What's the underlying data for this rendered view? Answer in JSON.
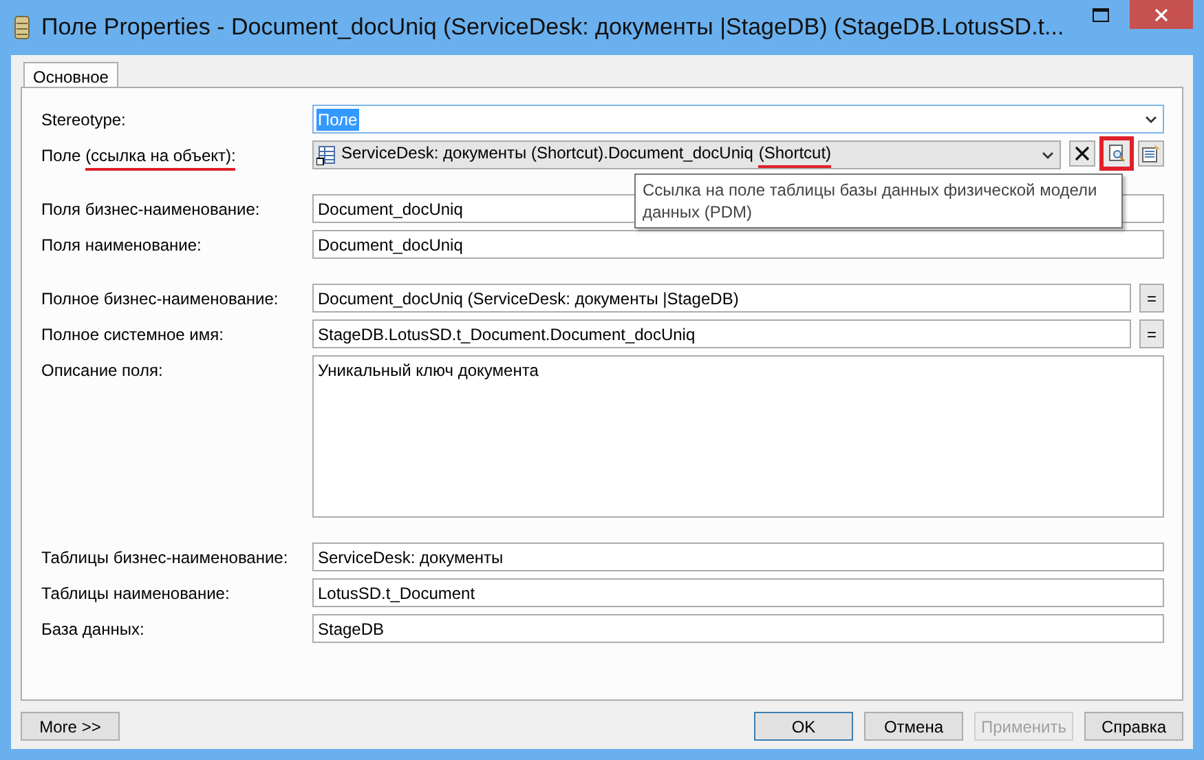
{
  "window": {
    "title": "Поле Properties - Document_docUniq (ServiceDesk: документы |StageDB) (StageDB.LotusSD.t..."
  },
  "tabs": [
    {
      "label": "Основное",
      "selected": true
    }
  ],
  "groups": [
    [
      {
        "kind": "combo",
        "label": "Stereotype:",
        "value": "Поле",
        "highlighted": true
      },
      {
        "kind": "object",
        "label": "Поле",
        "label_note": "(ссылка на объект):",
        "label_marked": true,
        "value": "ServiceDesk: документы (Shortcut).Document_docUniq",
        "value_note": "(Shortcut)",
        "value_marked": true,
        "tools": [
          {
            "kind": "clear",
            "marked": false
          },
          {
            "kind": "find",
            "marked": true
          },
          {
            "kind": "properties",
            "marked": false
          }
        ]
      }
    ],
    [
      {
        "kind": "text",
        "label": "Поля бизнес-наименование:",
        "value": "Document_docUniq"
      },
      {
        "kind": "text",
        "label": "Поля наименование:",
        "value": "Document_docUniq"
      }
    ],
    [
      {
        "kind": "text-eq",
        "label": "Полное бизнес-наименование:",
        "value": "Document_docUniq (ServiceDesk: документы |StageDB)",
        "button": "="
      },
      {
        "kind": "text-eq",
        "label": "Полное системное имя:",
        "value": "StageDB.LotusSD.t_Document.Document_docUniq",
        "button": "="
      },
      {
        "kind": "area",
        "label": "Описание поля:",
        "value": "Уникальный ключ документа"
      }
    ],
    [
      {
        "kind": "text",
        "label": "Таблицы бизнес-наименование:",
        "value": "ServiceDesk: документы"
      },
      {
        "kind": "text",
        "label": "Таблицы наименование:",
        "value": "LotusSD.t_Document"
      },
      {
        "kind": "text",
        "label": "База данных:",
        "value": "StageDB"
      }
    ]
  ],
  "tooltip": {
    "text": "Ссылка на поле таблицы базы данных физической модели данных (PDM)"
  },
  "more_button": "More >>",
  "buttons": [
    {
      "label": "OK",
      "default": true,
      "disabled": false
    },
    {
      "label": "Отмена",
      "default": false,
      "disabled": false
    },
    {
      "label": "Применить",
      "default": false,
      "disabled": true
    },
    {
      "label": "Справка",
      "default": false,
      "disabled": false
    }
  ]
}
